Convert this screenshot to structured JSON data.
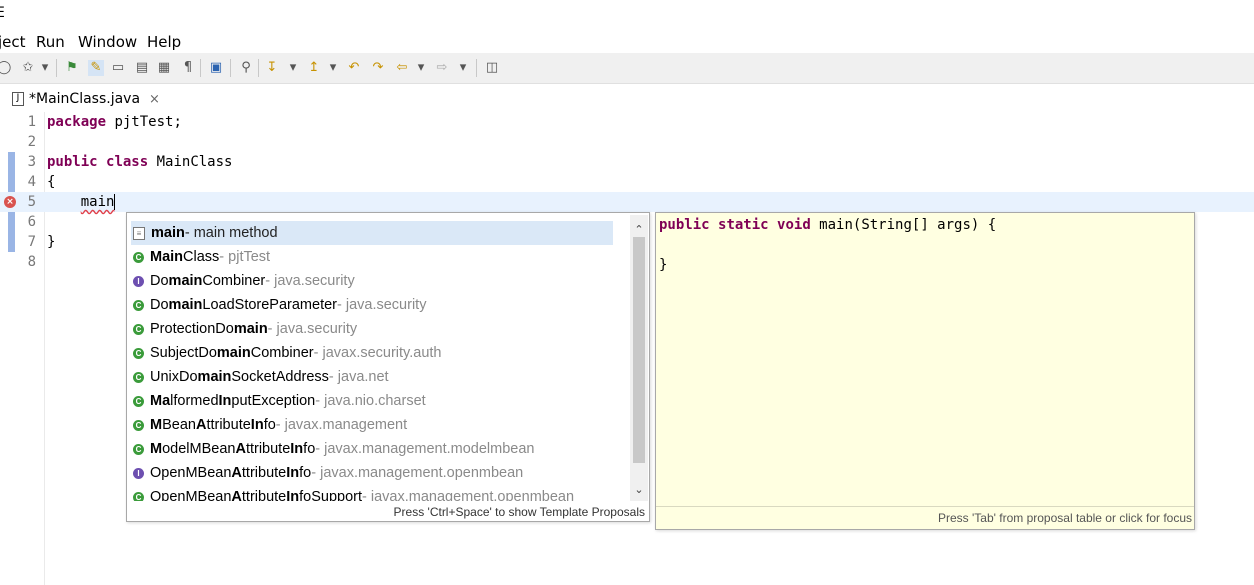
{
  "title_fragment": "E",
  "menu": [
    {
      "label": "ject"
    },
    {
      "label": "Run"
    },
    {
      "label": "Window"
    },
    {
      "label": "Help"
    }
  ],
  "editor_tab": {
    "label": "*MainClass.java",
    "close": "×"
  },
  "code_lines": [
    {
      "no": "1",
      "segments": [
        {
          "t": "package",
          "kw": true
        },
        {
          "t": " pjtTest;"
        }
      ]
    },
    {
      "no": "2",
      "segments": []
    },
    {
      "no": "3",
      "segments": [
        {
          "t": "public",
          "kw": true
        },
        {
          "t": " "
        },
        {
          "t": "class",
          "kw": true
        },
        {
          "t": " MainClass"
        }
      ]
    },
    {
      "no": "4",
      "segments": [
        {
          "t": "{"
        }
      ]
    },
    {
      "no": "5",
      "segments": [
        {
          "t": "    "
        },
        {
          "t": "main",
          "err": true
        }
      ]
    },
    {
      "no": "6",
      "segments": []
    },
    {
      "no": "7",
      "segments": [
        {
          "t": "}"
        }
      ]
    },
    {
      "no": "8",
      "segments": []
    }
  ],
  "proposals": {
    "items": [
      {
        "kind": "tpl",
        "parts": [
          {
            "t": "main",
            "b": true
          }
        ],
        "desc": " - main method",
        "qualifier": ""
      },
      {
        "kind": "class",
        "parts": [
          {
            "t": "Main",
            "b": true
          },
          {
            "t": "Class"
          }
        ],
        "desc": "",
        "qualifier": " - pjtTest"
      },
      {
        "kind": "iface",
        "parts": [
          {
            "t": "Do"
          },
          {
            "t": "main",
            "b": true
          },
          {
            "t": "Combiner"
          }
        ],
        "desc": "",
        "qualifier": " - java.security"
      },
      {
        "kind": "class",
        "parts": [
          {
            "t": "Do"
          },
          {
            "t": "main",
            "b": true
          },
          {
            "t": "LoadStoreParameter"
          }
        ],
        "desc": "",
        "qualifier": " - java.security"
      },
      {
        "kind": "class",
        "parts": [
          {
            "t": "ProtectionDo"
          },
          {
            "t": "main",
            "b": true
          }
        ],
        "desc": "",
        "qualifier": " - java.security"
      },
      {
        "kind": "class",
        "parts": [
          {
            "t": "SubjectDo"
          },
          {
            "t": "main",
            "b": true
          },
          {
            "t": "Combiner"
          }
        ],
        "desc": "",
        "qualifier": " - javax.security.auth"
      },
      {
        "kind": "class",
        "parts": [
          {
            "t": "UnixDo"
          },
          {
            "t": "main",
            "b": true
          },
          {
            "t": "SocketAddress"
          }
        ],
        "desc": "",
        "qualifier": " - java.net"
      },
      {
        "kind": "class",
        "parts": [
          {
            "t": "Ma",
            "b": true
          },
          {
            "t": "lformed"
          },
          {
            "t": "In",
            "b": true
          },
          {
            "t": "putException"
          }
        ],
        "desc": "",
        "qualifier": " - java.nio.charset"
      },
      {
        "kind": "class",
        "parts": [
          {
            "t": "M",
            "b": true
          },
          {
            "t": "Bean"
          },
          {
            "t": "A",
            "b": true
          },
          {
            "t": "ttribute"
          },
          {
            "t": "In",
            "b": true
          },
          {
            "t": "fo"
          }
        ],
        "desc": "",
        "qualifier": " - javax.management"
      },
      {
        "kind": "class",
        "parts": [
          {
            "t": "M",
            "b": true
          },
          {
            "t": "odelMBean"
          },
          {
            "t": "A",
            "b": true
          },
          {
            "t": "ttribute"
          },
          {
            "t": "In",
            "b": true
          },
          {
            "t": "fo"
          }
        ],
        "desc": "",
        "qualifier": " - javax.management.modelmbean"
      },
      {
        "kind": "iface",
        "parts": [
          {
            "t": "OpenMBean"
          },
          {
            "t": "A",
            "b": true
          },
          {
            "t": "ttribute"
          },
          {
            "t": "In",
            "b": true
          },
          {
            "t": "fo"
          }
        ],
        "desc": "",
        "qualifier": " - javax.management.openmbean"
      },
      {
        "kind": "class",
        "parts": [
          {
            "t": "OpenMBean"
          },
          {
            "t": "A",
            "b": true
          },
          {
            "t": "ttribute"
          },
          {
            "t": "In",
            "b": true
          },
          {
            "t": "foSupport"
          }
        ],
        "desc": "",
        "qualifier": " - javax.management.openmbean"
      }
    ],
    "status": "Press 'Ctrl+Space' to show Template Proposals"
  },
  "info_popup": {
    "code_segments": [
      {
        "t": "public",
        "kw": true
      },
      {
        "t": " "
      },
      {
        "t": "static",
        "kw": true
      },
      {
        "t": " "
      },
      {
        "t": "void",
        "kw": true
      },
      {
        "t": " main(String[] args) {\n\n}"
      }
    ],
    "footer": "Press 'Tab' from proposal table or click for focus"
  }
}
